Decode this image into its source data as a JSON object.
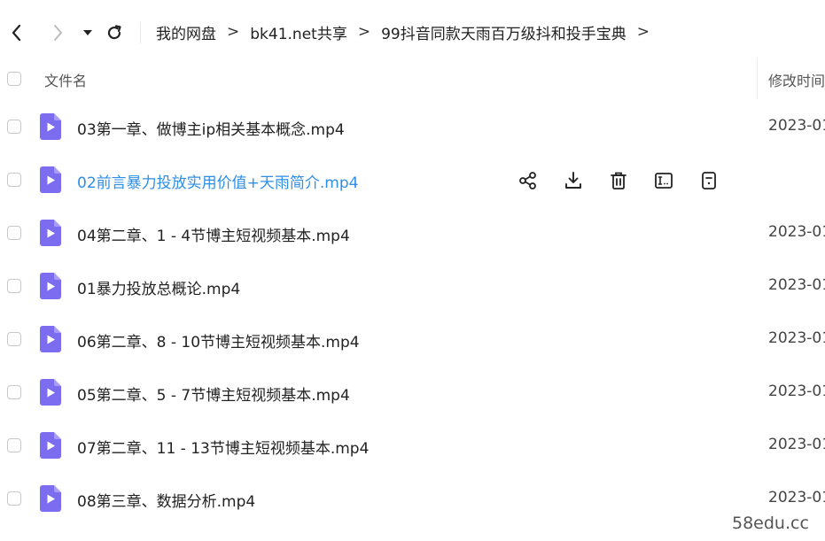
{
  "breadcrumb": {
    "items": [
      "我的网盘",
      "bk41.net共享",
      "99抖音同款天雨百万级抖和投手宝典"
    ],
    "separator": ">"
  },
  "columns": {
    "name": "文件名",
    "modified": "修改时间"
  },
  "files": [
    {
      "name": "03第一章、做博主ip相关基本概念.mp4",
      "date": "2023-01"
    },
    {
      "name": "02前言暴力投放实用价值+天雨简介.mp4",
      "date": ""
    },
    {
      "name": "04第二章、1 - 4节博主短视频基本.mp4",
      "date": "2023-01"
    },
    {
      "name": "01暴力投放总概论.mp4",
      "date": "2023-01"
    },
    {
      "name": "06第二章、8 - 10节博主短视频基本.mp4",
      "date": "2023-01"
    },
    {
      "name": "05第二章、5 - 7节博主短视频基本.mp4",
      "date": "2023-01"
    },
    {
      "name": "07第二章、11 - 13节博主短视频基本.mp4",
      "date": "2023-01"
    },
    {
      "name": "08第三章、数据分析.mp4",
      "date": "2023-01"
    }
  ],
  "hovered_row_icons": [
    "share-icon",
    "download-icon",
    "delete-icon",
    "rename-icon",
    "more-info-icon"
  ],
  "colors": {
    "accent": "#2f8ee8",
    "file_icon": "#7c6cf0"
  },
  "watermark": "58edu.cc"
}
